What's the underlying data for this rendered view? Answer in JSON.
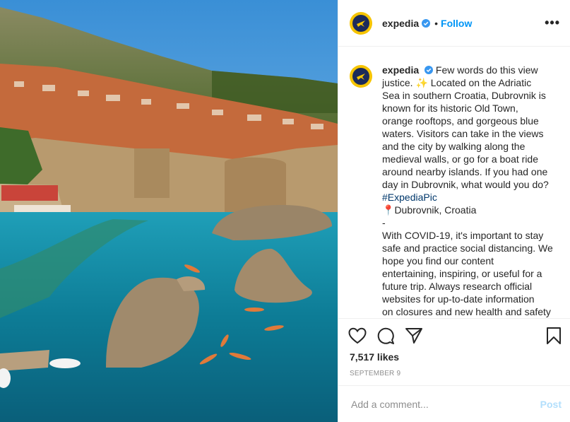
{
  "post": {
    "username": "expedia",
    "follow_label": "Follow",
    "dot": "•",
    "more_label": "•••",
    "caption_lines": [
      "Few words do this view",
      "justice. ✨ Located on the Adriatic",
      "Sea in southern Croatia, Dubrovnik is",
      "known for its historic Old Town,",
      "orange rooftops, and gorgeous blue",
      "waters. Visitors can take in the views",
      "and the city by walking along the",
      "medieval walls, or go for a boat ride",
      "around nearby islands. If you had one",
      "day in Dubrovnik, what would you do?"
    ],
    "hashtag": "#ExpediaPic",
    "location_pin": "📍",
    "location": "Dubrovnik, Croatia",
    "separator": "-",
    "covid_lines": [
      "With COVID-19, it's important to stay",
      "safe and practice social distancing. We",
      "hope you find our content",
      "entertaining, inspiring, or useful for a",
      "future trip. Always research official",
      "websites for up-to-date information",
      "on closures and new health and safety"
    ],
    "likes": "7,517 likes",
    "date": "SEPTEMBER 9",
    "comment_placeholder": "Add a comment...",
    "post_label": "Post"
  },
  "icons": {
    "like": "heart-icon",
    "comment": "comment-icon",
    "share": "share-icon",
    "save": "bookmark-icon",
    "verified": "verified-badge-icon",
    "avatar": "expedia-logo-icon"
  },
  "colors": {
    "follow": "#0095f6",
    "hashtag": "#00376b",
    "avatar_ring": "#f6c400",
    "avatar_fill": "#1c2b5a",
    "verified": "#3897f0",
    "meta": "#8e8e8e"
  }
}
